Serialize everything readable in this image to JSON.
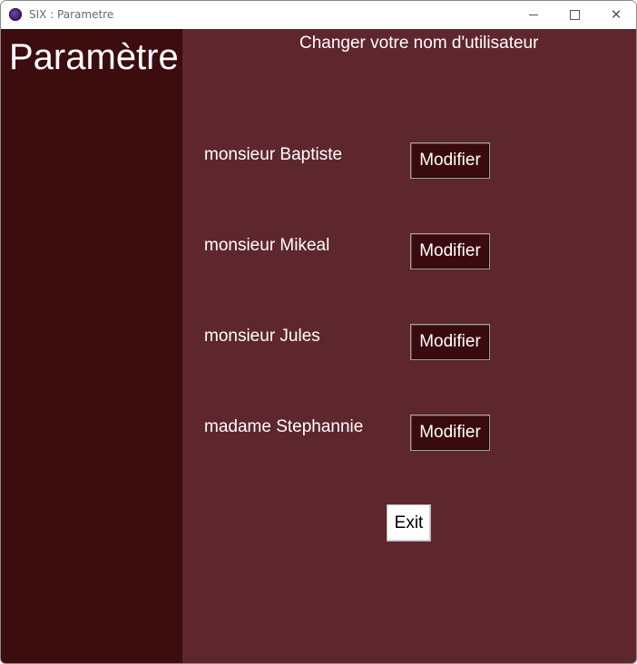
{
  "window": {
    "title": "SIX : Parametre",
    "controls": {
      "minimize": "minimize-icon",
      "maximize": "maximize-icon",
      "close": "close-icon"
    }
  },
  "sidebar": {
    "title": "Paramètre",
    "background": "#3c0c0f"
  },
  "main": {
    "heading": "Changer votre nom d'utilisateur",
    "background": "#5e262d",
    "users": [
      {
        "name": "monsieur Baptiste",
        "button": "Modifier"
      },
      {
        "name": "monsieur Mikeal",
        "button": "Modifier"
      },
      {
        "name": "monsieur Jules",
        "button": "Modifier"
      },
      {
        "name": "madame Stephannie",
        "button": "Modifier"
      }
    ],
    "exit_label": "Exit"
  },
  "colors": {
    "button_bg": "#3a0b0e",
    "text": "#ffffff"
  }
}
